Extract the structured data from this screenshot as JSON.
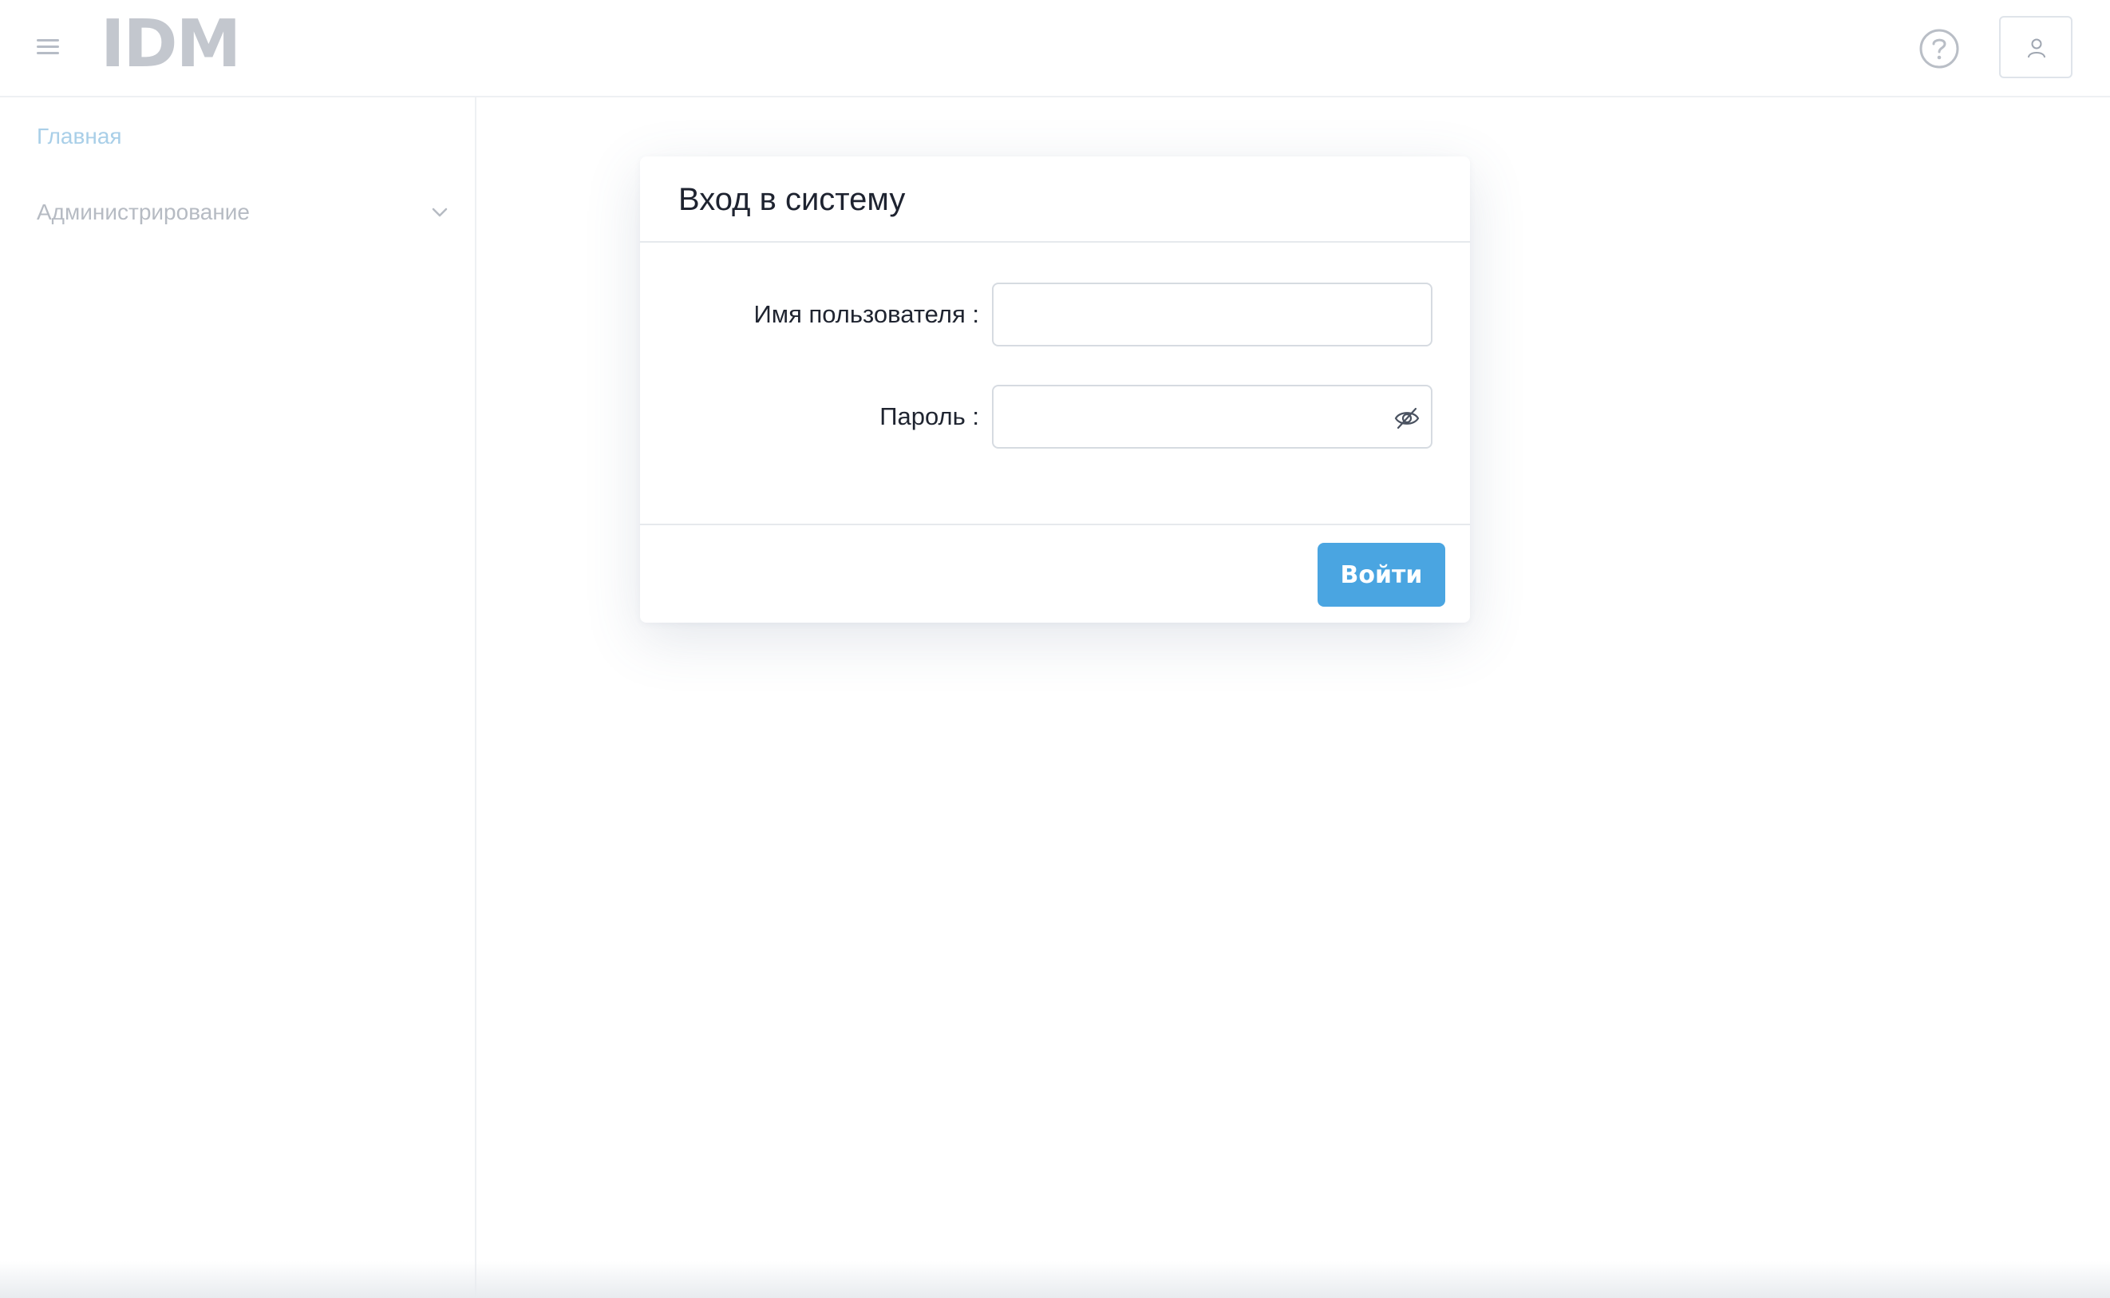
{
  "header": {
    "logo_text": "IDM",
    "menu_icon": "hamburger-menu-icon",
    "help_icon": "question-circle-icon",
    "user_icon": "user-icon"
  },
  "sidebar": {
    "items": [
      {
        "label": "Главная",
        "active": true
      },
      {
        "label": "Администрирование",
        "expandable": true,
        "icon": "chevron-down-icon"
      }
    ]
  },
  "login_card": {
    "title": "Вход в систему",
    "username_label": "Имя пользователя :",
    "username_value": "",
    "password_label": "Пароль :",
    "password_value": "",
    "password_toggle_icon": "eye-slash-icon",
    "submit_label": "Войти"
  },
  "colors": {
    "accent": "#4aa5e1",
    "logo": "#c3c7ce",
    "sidebar_active": "#a9cfe8",
    "sidebar_inactive": "#b6bbc3"
  }
}
